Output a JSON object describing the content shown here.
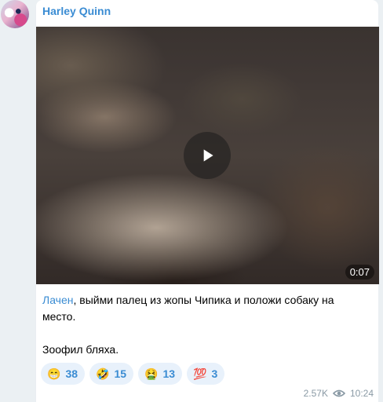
{
  "message": {
    "sender": "Harley Quinn",
    "video": {
      "duration": "0:07"
    },
    "mention": "Лачен",
    "text_line1_rest": ", выйми палец из жопы Чипика и положи собаку на место.",
    "text_line2": "Зоофил бляха.",
    "reactions": [
      {
        "emoji": "😁",
        "count": "38"
      },
      {
        "emoji": "🤣",
        "count": "15"
      },
      {
        "emoji": "🤮",
        "count": "13"
      },
      {
        "emoji": "💯",
        "count": "3"
      }
    ],
    "views": "2.57K",
    "time": "10:24"
  },
  "colors": {
    "accent": "#3a8cd3",
    "background": "#ebf0f3",
    "bubble": "#ffffff",
    "reaction_bg": "#e8f1fb",
    "meta": "#8a9aa5"
  },
  "icons": [
    "avatar-image",
    "play-icon",
    "eye-icon"
  ]
}
